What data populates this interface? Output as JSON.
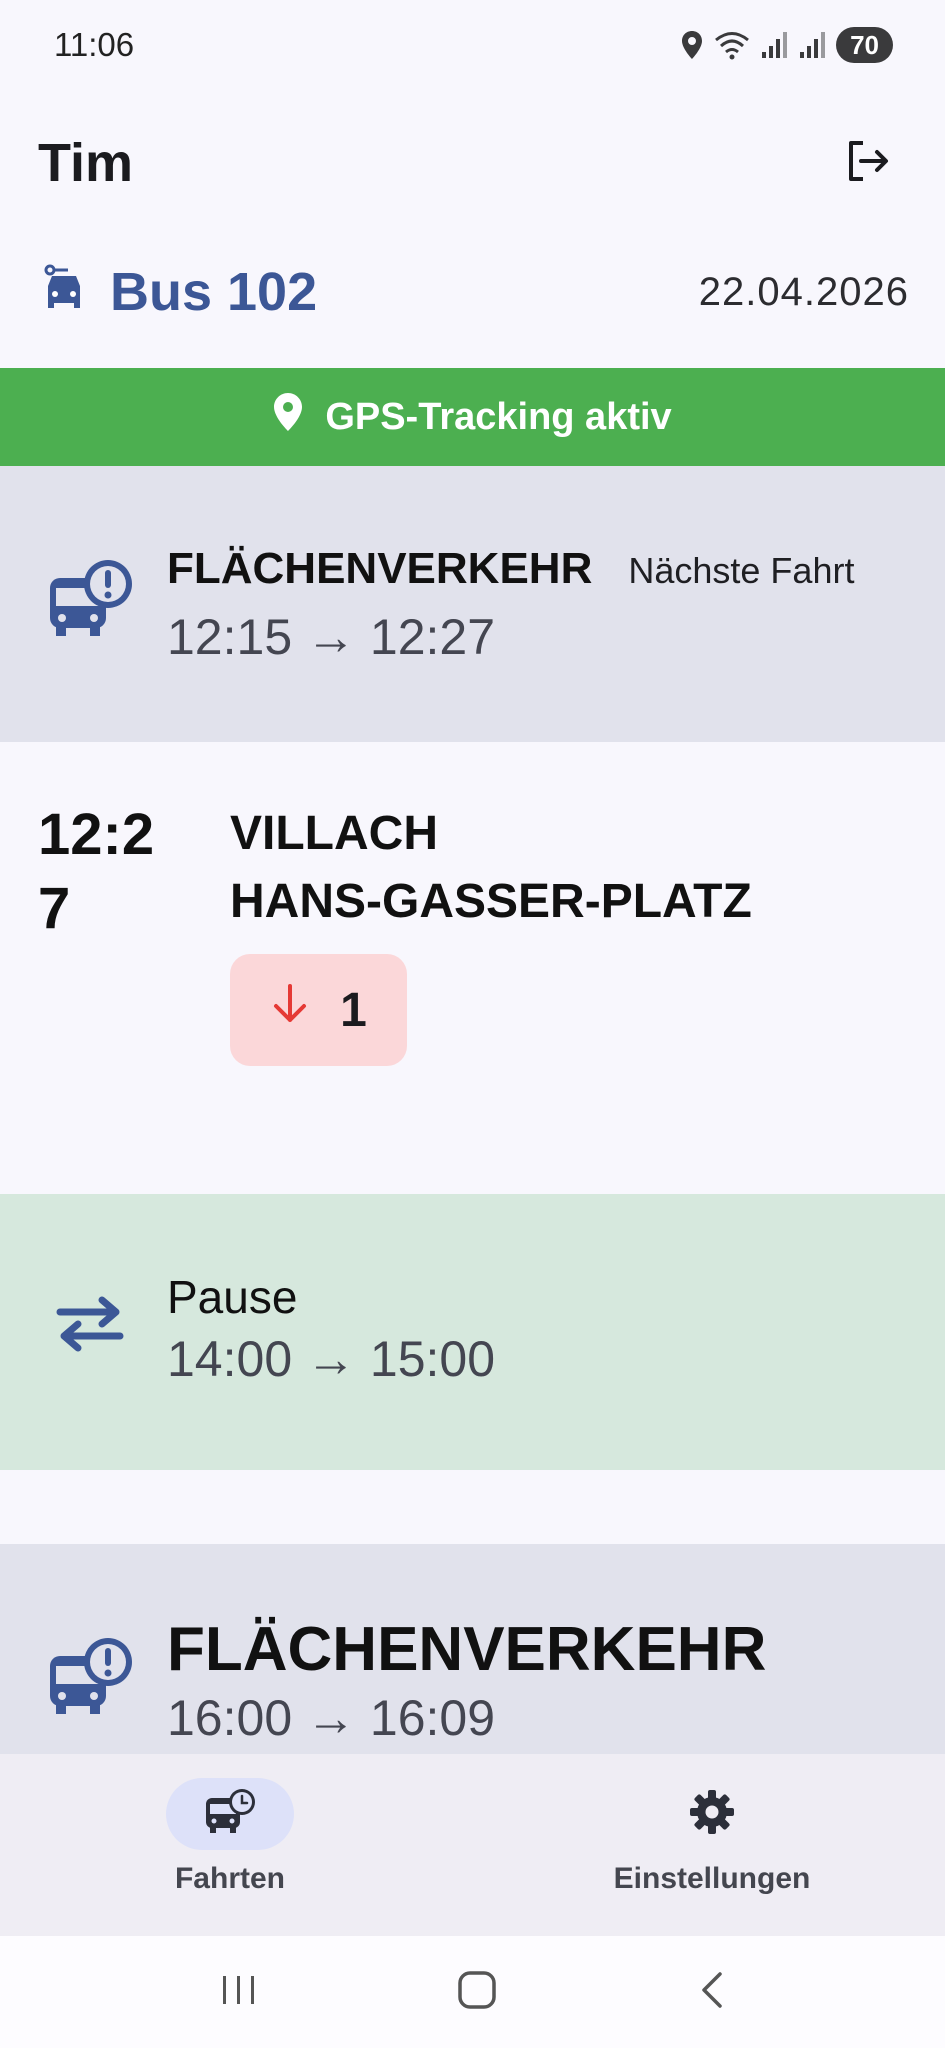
{
  "status_bar": {
    "time": "11:06",
    "battery": "70",
    "icons": [
      "location-icon",
      "wifi-icon",
      "signal-icon",
      "signal-icon",
      "battery-icon"
    ]
  },
  "header": {
    "user_name": "Tim",
    "logout_icon": "logout-icon"
  },
  "vehicle": {
    "name": "Bus 102",
    "date": "22.04.2026",
    "icon": "car-icon"
  },
  "gps_banner": {
    "text": "GPS-Tracking aktiv",
    "icon": "location-pin-icon",
    "color": "#4caf50"
  },
  "trips": [
    {
      "title": "FLÄCHENVERKEHR",
      "badge": "Nächste Fahrt",
      "time": "12:15 → 12:27",
      "icon": "bus-alert-icon"
    },
    {
      "title": "FLÄCHENVERKEHR",
      "time": "16:00 → 16:09",
      "icon": "bus-alert-icon"
    }
  ],
  "stop": {
    "time": "12:27",
    "name_line1": "VILLACH",
    "name_line2": "HANS-GASSER-PLATZ",
    "alighting_count": "1",
    "alighting_icon": "arrow-down-icon"
  },
  "pause": {
    "title": "Pause",
    "time": "14:00 → 15:00",
    "icon": "swap-horizontal-icon"
  },
  "bottom_nav": {
    "items": [
      {
        "label": "Fahrten",
        "icon": "bus-clock-icon",
        "active": true
      },
      {
        "label": "Einstellungen",
        "icon": "gear-icon",
        "active": false
      }
    ]
  },
  "colors": {
    "accent": "#3c5796",
    "card_gray": "#e1e2ec",
    "pause_green": "#d6e8dd",
    "badge_red": "#fbd7d9",
    "arrow_red": "#e53935"
  }
}
